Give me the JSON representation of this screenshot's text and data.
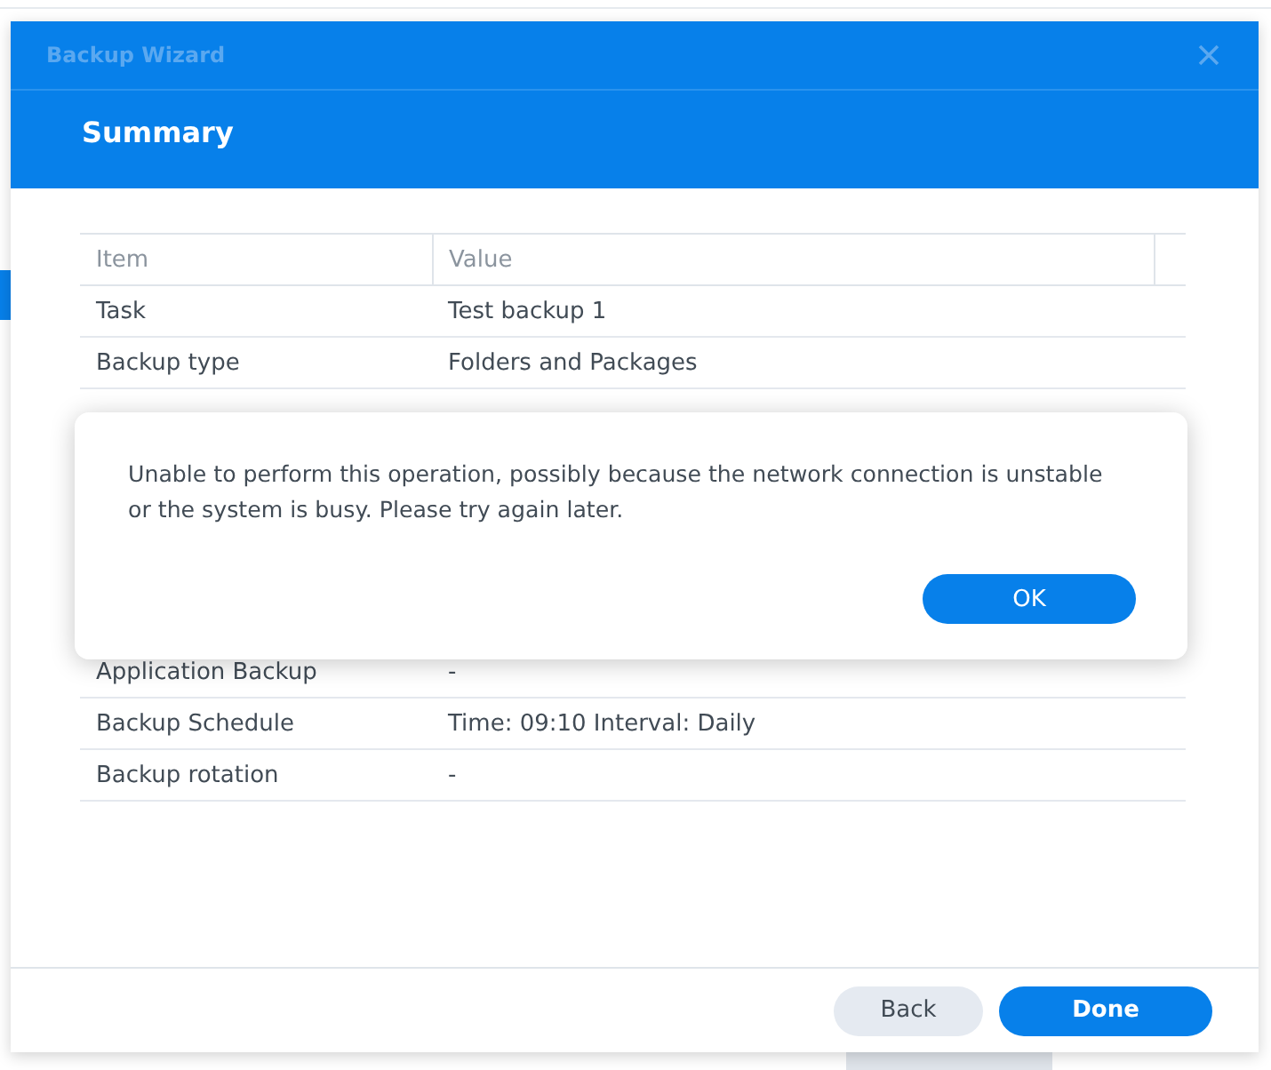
{
  "window": {
    "title": "Backup Wizard"
  },
  "step_title": "Summary",
  "table": {
    "columns": [
      "Item",
      "Value"
    ],
    "rows": [
      {
        "item": "Task",
        "value": "Test backup 1"
      },
      {
        "item": "Backup type",
        "value": "Folders and Packages"
      },
      {
        "item": "Application Backup",
        "value": "-"
      },
      {
        "item": "Backup Schedule",
        "value": "Time: 09:10 Interval: Daily"
      },
      {
        "item": "Backup rotation",
        "value": "-"
      }
    ]
  },
  "footer_buttons": [
    {
      "label": "Back",
      "kind": "secondary"
    },
    {
      "label": "Done",
      "kind": "primary"
    }
  ],
  "alert": {
    "message": "Unable to perform this operation, possibly because the network connection is unstable or the system is busy. Please try again later.",
    "button": "OK"
  }
}
